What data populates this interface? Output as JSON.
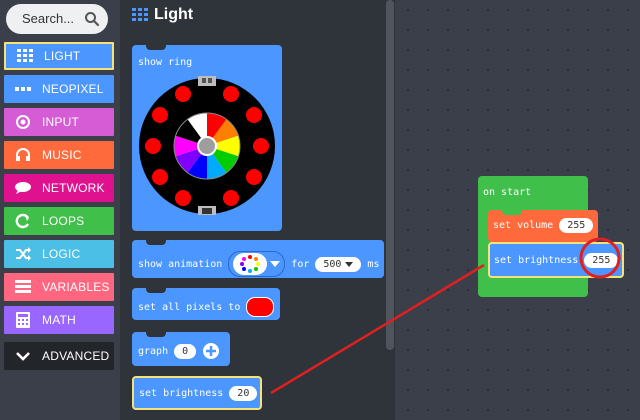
{
  "search": {
    "placeholder": "Search..."
  },
  "categories": [
    {
      "label": "LIGHT",
      "icon": "grid-icon",
      "color": "#4c97ff"
    },
    {
      "label": "NEOPIXEL",
      "icon": "dots-icon",
      "color": "#4c97ff"
    },
    {
      "label": "INPUT",
      "icon": "circle-target-icon",
      "color": "#d65cd6"
    },
    {
      "label": "MUSIC",
      "icon": "headphones-icon",
      "color": "#ff6a3d"
    },
    {
      "label": "NETWORK",
      "icon": "chat-icon",
      "color": "#e0118f"
    },
    {
      "label": "LOOPS",
      "icon": "loop-icon",
      "color": "#40bf4a"
    },
    {
      "label": "LOGIC",
      "icon": "shuffle-icon",
      "color": "#4cbfe6"
    },
    {
      "label": "VARIABLES",
      "icon": "list-icon",
      "color": "#ff6680"
    },
    {
      "label": "MATH",
      "icon": "calculator-icon",
      "color": "#9966ff"
    },
    {
      "label": "ADVANCED",
      "icon": "chevron-down-icon",
      "color": "#222529"
    }
  ],
  "flyout": {
    "title": "Light",
    "blocks": {
      "show_ring": "show ring",
      "show_animation": "show animation",
      "for_label": "for",
      "ms_value": "500",
      "ms_label": "ms",
      "set_all_pixels": "set all pixels to",
      "graph": "graph",
      "graph_value": "0",
      "set_brightness": "set brightness",
      "brightness_value": "20"
    }
  },
  "workspace": {
    "on_start": "on start",
    "set_volume": "set volume",
    "volume_value": "255",
    "set_brightness": "set brightness",
    "brightness_value": "255"
  },
  "colors": {
    "accent_red": "#e02020",
    "loops_green": "#40bf4a",
    "music_orange": "#ff6a3d",
    "light_blue": "#4c97ff"
  }
}
